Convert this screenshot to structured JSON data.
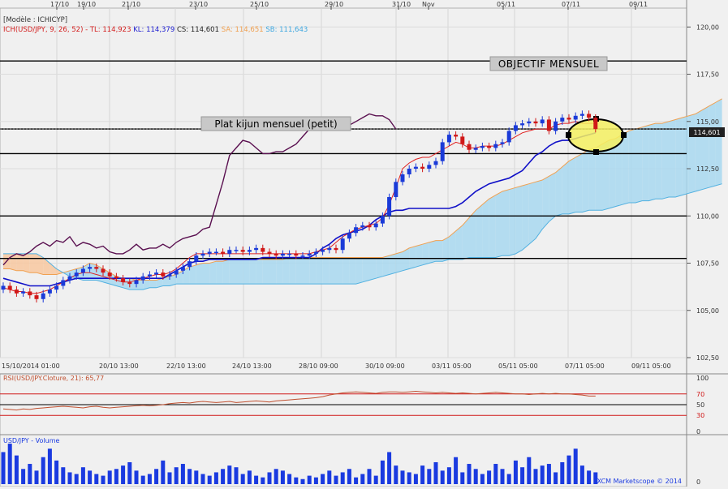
{
  "header": {
    "model": "[Modèle : ICHICYP]",
    "legend_prefix": "ICH(USD/JPY, 9, 26, 52) -",
    "legend_items": [
      {
        "label": "TL: 114,923",
        "color": "#d42020"
      },
      {
        "label": "KL: 114,379",
        "color": "#1a1ad0"
      },
      {
        "label": "CS: 114,601",
        "color": "#202020"
      },
      {
        "label": "SA: 114,651",
        "color": "#f0a050"
      },
      {
        "label": "SB: 111,643",
        "color": "#40a8e0"
      }
    ]
  },
  "annotations": {
    "objectif": "OBJECTIF MENSUEL",
    "kijun": "Plat kijun mensuel (petit)"
  },
  "price_tag": "114,601",
  "top_dates": [
    "17/10",
    "19/10",
    "21/10",
    "23/10",
    "25/10",
    "29/10",
    "31/10",
    "Nov",
    "05/11",
    "07/11",
    "09/11"
  ],
  "bottom_dates": [
    "15/10/2014 01:00",
    "20/10 13:00",
    "22/10 13:00",
    "24/10 13:00",
    "28/10 09:00",
    "30/10 09:00",
    "03/11 05:00",
    "05/11 05:00",
    "07/11 05:00",
    "09/11 05:00"
  ],
  "rsi": {
    "label": "RSI(USD/JPY.Cloture, 21): 65,77",
    "levels": [
      "100",
      "70",
      "50",
      "30",
      "0"
    ]
  },
  "volume": {
    "label": "USD/JPY - Volume",
    "zero": "0"
  },
  "watermark": "FXCM Marketscope © 2014",
  "colors": {
    "tenkan": "#e02020",
    "kijun": "#1010c8",
    "chikou": "#5a1050",
    "span_a": "#f0a050",
    "span_b": "#50b0e0",
    "bull": "#1a3ad8",
    "bear": "#d01818",
    "rsi": "#c05030",
    "volume": "#1a3ae0"
  },
  "chart_data": {
    "type": "candlestick",
    "instrument": "USD/JPY",
    "ylim": [
      102.5,
      121.0
    ],
    "y_ticks": [
      102.5,
      105.0,
      107.5,
      110.0,
      112.5,
      115.0,
      117.5,
      120.0
    ],
    "y_tick_labels": [
      "102,50",
      "105,00",
      "107,50",
      "110,00",
      "112,50",
      "115,00",
      "117,50",
      "120,00"
    ],
    "horizontal_levels": [
      118.2,
      114.6,
      113.3,
      110.0,
      107.75
    ],
    "close": [
      106.3,
      106.1,
      105.9,
      106.0,
      105.8,
      105.6,
      105.9,
      106.1,
      106.3,
      106.6,
      106.8,
      107.0,
      107.2,
      107.3,
      107.2,
      107.0,
      106.8,
      106.7,
      106.5,
      106.4,
      106.6,
      106.8,
      106.9,
      107.0,
      106.8,
      106.9,
      107.1,
      107.3,
      107.6,
      107.9,
      108.0,
      108.1,
      108.1,
      108.0,
      108.2,
      108.2,
      108.1,
      108.2,
      108.3,
      108.1,
      108.0,
      107.9,
      108.0,
      108.0,
      107.9,
      107.9,
      108.0,
      108.1,
      108.2,
      108.3,
      108.2,
      108.8,
      109.1,
      109.4,
      109.5,
      109.4,
      109.6,
      110.0,
      111.0,
      111.8,
      112.2,
      112.5,
      112.6,
      112.5,
      112.7,
      112.9,
      113.9,
      114.3,
      114.2,
      113.8,
      113.5,
      113.6,
      113.7,
      113.6,
      113.8,
      113.9,
      114.5,
      114.8,
      114.9,
      115.0,
      114.9,
      115.1,
      114.5,
      115.0,
      115.2,
      115.1,
      115.3,
      115.4,
      115.2,
      114.6
    ],
    "tenkan": [
      106.2,
      106.1,
      106.0,
      106.0,
      105.9,
      105.9,
      106.0,
      106.1,
      106.3,
      106.5,
      106.7,
      106.9,
      107.0,
      107.0,
      106.9,
      106.8,
      106.7,
      106.6,
      106.5,
      106.5,
      106.6,
      106.7,
      106.8,
      106.9,
      106.9,
      107.0,
      107.2,
      107.5,
      107.8,
      108.0,
      108.0,
      108.0,
      108.0,
      108.0,
      108.0,
      108.0,
      108.0,
      108.0,
      108.0,
      108.0,
      108.0,
      108.0,
      108.0,
      108.0,
      108.0,
      108.0,
      108.0,
      108.1,
      108.2,
      108.3,
      108.6,
      108.9,
      109.1,
      109.3,
      109.4,
      109.5,
      109.6,
      109.9,
      110.6,
      111.5,
      112.5,
      112.8,
      113.0,
      113.1,
      113.1,
      113.3,
      113.5,
      113.7,
      113.9,
      113.8,
      113.6,
      113.6,
      113.7,
      113.7,
      113.7,
      113.8,
      114.0,
      114.2,
      114.4,
      114.5,
      114.6,
      114.6,
      114.6,
      114.8,
      114.9,
      114.9,
      115.0,
      114.9,
      114.9,
      114.9
    ],
    "kijun": [
      106.7,
      106.6,
      106.5,
      106.4,
      106.3,
      106.3,
      106.3,
      106.3,
      106.4,
      106.5,
      106.6,
      106.7,
      106.7,
      106.7,
      106.7,
      106.7,
      106.7,
      106.7,
      106.7,
      106.7,
      106.7,
      106.7,
      106.7,
      106.7,
      106.7,
      106.9,
      107.1,
      107.3,
      107.5,
      107.6,
      107.6,
      107.7,
      107.7,
      107.7,
      107.7,
      107.7,
      107.7,
      107.7,
      107.7,
      107.8,
      107.8,
      107.8,
      107.8,
      107.8,
      107.8,
      107.8,
      107.8,
      108.0,
      108.3,
      108.5,
      108.8,
      109.0,
      109.1,
      109.2,
      109.3,
      109.5,
      109.8,
      110.0,
      110.2,
      110.3,
      110.3,
      110.4,
      110.4,
      110.4,
      110.4,
      110.4,
      110.4,
      110.4,
      110.5,
      110.7,
      111.0,
      111.3,
      111.5,
      111.7,
      111.8,
      111.9,
      112.0,
      112.2,
      112.4,
      112.8,
      113.2,
      113.4,
      113.7,
      113.9,
      114.0,
      114.0,
      114.1,
      114.2,
      114.3,
      114.4
    ],
    "chikou": [
      107.4,
      107.8,
      108.0,
      107.9,
      108.1,
      108.4,
      108.6,
      108.4,
      108.7,
      108.6,
      108.9,
      108.4,
      108.6,
      108.5,
      108.3,
      108.4,
      108.1,
      108.0,
      108.0,
      108.2,
      108.5,
      108.2,
      108.3,
      108.3,
      108.5,
      108.3,
      108.6,
      108.8,
      108.9,
      109.0,
      109.3,
      109.4,
      110.6,
      111.8,
      113.2,
      113.6,
      114.0,
      113.9,
      113.6,
      113.3,
      113.3,
      113.4,
      113.4,
      113.6,
      113.8,
      114.2,
      114.6,
      115.0,
      114.6,
      114.6,
      114.6,
      114.6,
      114.8,
      115.0,
      115.2,
      115.4,
      115.3,
      115.3,
      115.1,
      114.6
    ],
    "span_a": [
      107.2,
      107.2,
      107.1,
      107.1,
      107.0,
      107.0,
      106.9,
      106.9,
      106.9,
      107.0,
      107.1,
      107.2,
      107.3,
      107.5,
      107.4,
      107.2,
      107.0,
      106.8,
      106.7,
      106.7,
      106.6,
      106.6,
      106.6,
      106.6,
      106.7,
      106.8,
      106.9,
      107.1,
      107.3,
      107.4,
      107.5,
      107.5,
      107.6,
      107.6,
      107.7,
      107.7,
      107.7,
      107.7,
      107.7,
      107.7,
      107.7,
      107.7,
      107.7,
      107.8,
      107.8,
      107.8,
      107.8,
      107.8,
      107.8,
      107.8,
      107.8,
      107.8,
      107.8,
      107.8,
      107.8,
      107.8,
      107.8,
      107.8,
      107.9,
      108.0,
      108.1,
      108.3,
      108.4,
      108.5,
      108.6,
      108.7,
      108.7,
      108.9,
      109.2,
      109.5,
      109.9,
      110.3,
      110.6,
      110.9,
      111.1,
      111.3,
      111.4,
      111.5,
      111.6,
      111.7,
      111.8,
      111.9,
      112.1,
      112.3,
      112.6,
      112.9,
      113.1,
      113.3,
      113.5,
      113.6,
      113.8,
      114.0,
      114.1,
      114.3,
      114.5,
      114.6,
      114.7,
      114.8,
      114.9,
      114.9,
      115.0,
      115.1,
      115.2,
      115.3,
      115.4,
      115.6,
      115.8,
      116.0,
      116.2
    ],
    "span_b": [
      108.0,
      108.0,
      108.0,
      108.0,
      108.0,
      108.0,
      107.8,
      107.5,
      107.2,
      107.0,
      106.8,
      106.7,
      106.6,
      106.6,
      106.6,
      106.5,
      106.4,
      106.3,
      106.2,
      106.1,
      106.1,
      106.1,
      106.2,
      106.2,
      106.3,
      106.3,
      106.4,
      106.4,
      106.4,
      106.4,
      106.4,
      106.4,
      106.4,
      106.4,
      106.4,
      106.4,
      106.4,
      106.4,
      106.4,
      106.4,
      106.4,
      106.4,
      106.4,
      106.4,
      106.4,
      106.4,
      106.4,
      106.4,
      106.4,
      106.4,
      106.4,
      106.4,
      106.4,
      106.4,
      106.5,
      106.6,
      106.7,
      106.8,
      106.9,
      107.0,
      107.1,
      107.2,
      107.3,
      107.4,
      107.5,
      107.6,
      107.6,
      107.7,
      107.7,
      107.7,
      107.8,
      107.8,
      107.8,
      107.8,
      107.8,
      107.9,
      107.9,
      108.0,
      108.2,
      108.5,
      108.8,
      109.3,
      109.7,
      110.0,
      110.1,
      110.1,
      110.2,
      110.2,
      110.3,
      110.3,
      110.3,
      110.4,
      110.5,
      110.6,
      110.7,
      110.7,
      110.8,
      110.8,
      110.9,
      110.9,
      111.0,
      111.0,
      111.1,
      111.2,
      111.3,
      111.4,
      111.5,
      111.6,
      111.7
    ],
    "rsi": [
      42,
      41,
      40,
      42,
      41,
      43,
      44,
      45,
      46,
      47,
      46,
      45,
      44,
      46,
      47,
      45,
      44,
      45,
      46,
      47,
      48,
      49,
      48,
      49,
      50,
      52,
      53,
      54,
      53,
      55,
      56,
      55,
      54,
      55,
      56,
      54,
      55,
      56,
      57,
      56,
      55,
      57,
      58,
      59,
      60,
      61,
      62,
      63,
      65,
      68,
      70,
      72,
      73,
      74,
      73,
      72,
      71,
      73,
      74,
      74,
      73,
      74,
      75,
      74,
      73,
      72,
      73,
      72,
      71,
      72,
      71,
      70,
      71,
      72,
      73,
      72,
      71,
      70,
      70,
      69,
      70,
      71,
      70,
      71,
      70,
      70,
      69,
      68,
      66,
      66
    ],
    "volume": [
      19,
      24,
      17,
      9,
      12,
      8,
      16,
      21,
      14,
      10,
      7,
      6,
      10,
      8,
      6,
      5,
      8,
      9,
      11,
      13,
      8,
      5,
      6,
      9,
      14,
      7,
      10,
      12,
      9,
      8,
      6,
      5,
      7,
      9,
      11,
      10,
      6,
      8,
      5,
      4,
      7,
      9,
      8,
      6,
      4,
      3,
      5,
      4,
      6,
      8,
      5,
      7,
      9,
      4,
      6,
      9,
      5,
      14,
      19,
      11,
      8,
      7,
      6,
      11,
      9,
      13,
      8,
      10,
      16,
      7,
      12,
      9,
      6,
      8,
      12,
      9,
      6,
      14,
      10,
      16,
      9,
      11,
      12,
      7,
      13,
      17,
      21,
      11,
      8,
      7
    ]
  }
}
